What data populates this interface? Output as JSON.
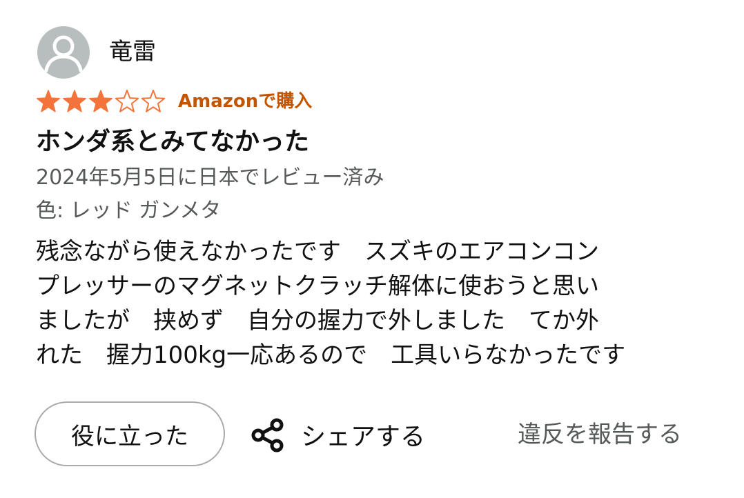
{
  "reviewer": {
    "name": "竜雷",
    "avatar_icon": "default-user-avatar-icon"
  },
  "rating": {
    "value": 3,
    "max": 5,
    "filled_color": "#f3733a",
    "empty_color": "#f3733a"
  },
  "purchase_badge": "Amazonで購入",
  "purchase_badge_color": "#c45500",
  "review": {
    "title": "ホンダ系とみてなかった",
    "date": "2024年5月5日に日本でレビュー済み",
    "variant": "色: レッド ガンメタ",
    "body_lines": [
      "残念ながら使えなかったです　スズキのエアコンコン",
      "プレッサーのマグネットクラッチ解体に使おうと思い",
      "ましたが　挟めず　自分の握力で外しました　てか外",
      "れた　握力100kg一応あるので　工具いらなかったです"
    ]
  },
  "actions": {
    "helpful_label": "役に立った",
    "share_label": "シェアする",
    "share_icon": "share-icon",
    "report_label": "違反を報告する"
  }
}
